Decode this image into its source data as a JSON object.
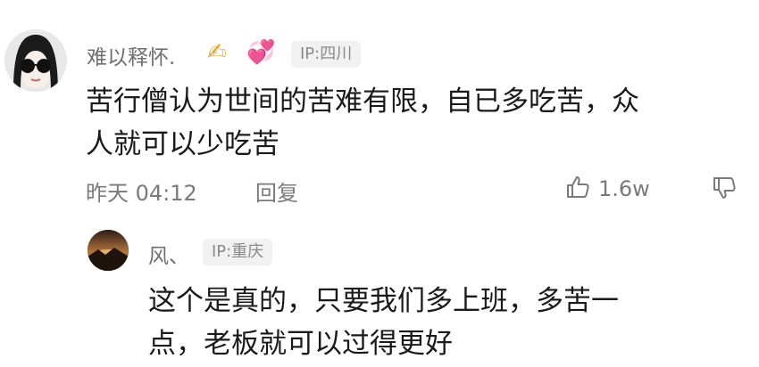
{
  "comment": {
    "username": "难以释怀.",
    "emoji_1": "✍",
    "emoji_2": "💞",
    "ip_label": "IP:四川",
    "text_line_1": "苦行僧认为世间的苦难有限，自已多吃苦，众",
    "text_line_2": "人就可以少吃苦",
    "timestamp": "昨天 04:12",
    "reply_label": "回复",
    "like_count": "1.6w"
  },
  "reply": {
    "username": "风、",
    "ip_label": "IP:重庆",
    "text_line_1": "这个是真的，只要我们多上班，多苦一",
    "text_line_2": "点，老板就可以过得更好"
  },
  "icons": {
    "like": "thumbs-up-icon",
    "dislike": "thumbs-down-icon"
  },
  "colors": {
    "username": "#6f6f6f",
    "comment_text": "#1a1a1a",
    "meta_text": "#7a7a7a",
    "badge_bg": "#f1f1f1"
  }
}
